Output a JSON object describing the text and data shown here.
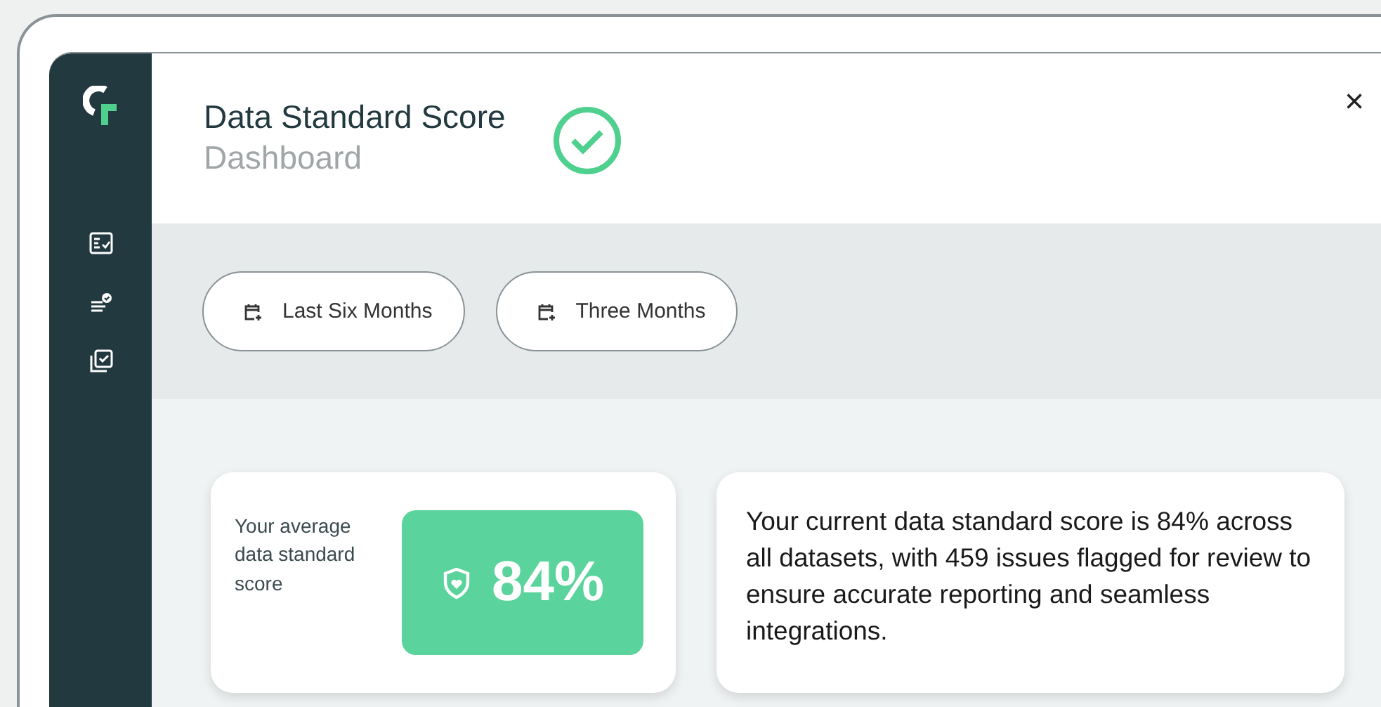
{
  "header": {
    "title": "Data Standard Score",
    "subtitle": "Dashboard",
    "close": "×"
  },
  "filters": [
    {
      "label": "Last Six Months"
    },
    {
      "label": "Three Months"
    }
  ],
  "score_card": {
    "label": "Your average data standard score",
    "value": "84%"
  },
  "summary": "Your current data standard score is 84% across all datasets, with 459 issues flagged for review to ensure accurate reporting and seamless integrations."
}
